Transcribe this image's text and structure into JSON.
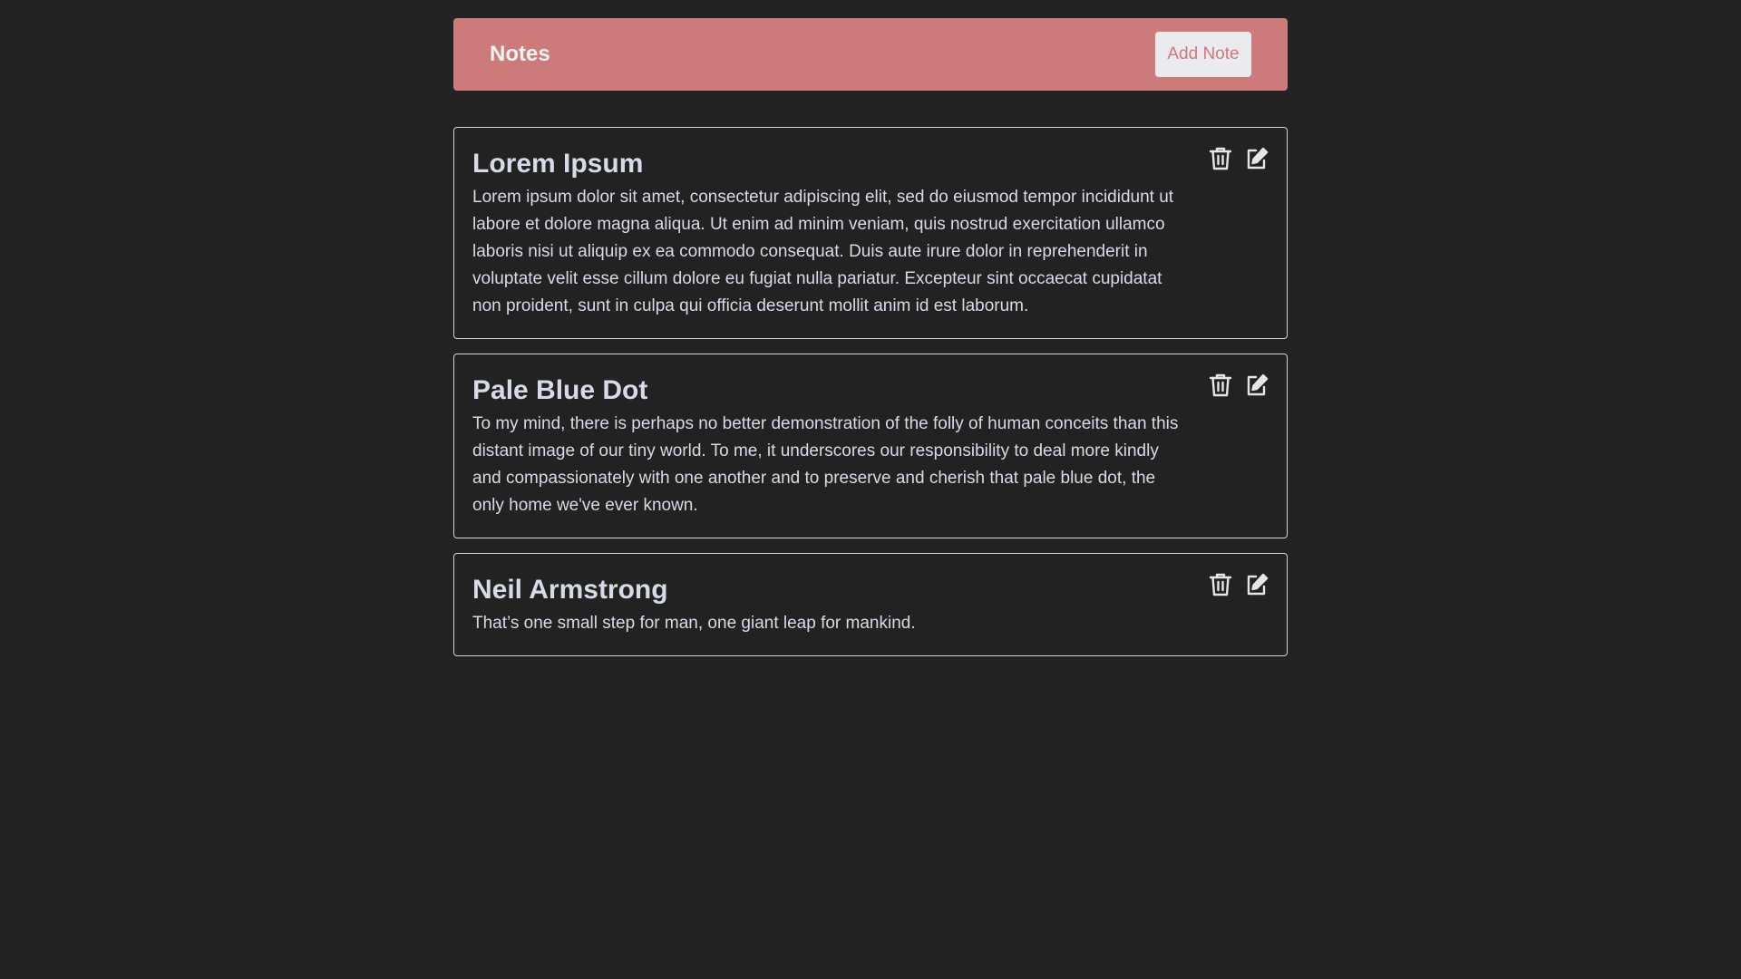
{
  "header": {
    "title": "Notes",
    "add_label": "Add Note"
  },
  "notes": [
    {
      "title": "Lorem Ipsum",
      "body": "Lorem ipsum dolor sit amet, consectetur adipiscing elit, sed do eiusmod tempor incididunt ut labore et dolore magna aliqua. Ut enim ad minim veniam, quis nostrud exercitation ullamco laboris nisi ut aliquip ex ea commodo consequat. Duis aute irure dolor in reprehenderit in voluptate velit esse cillum dolore eu fugiat nulla pariatur. Excepteur sint occaecat cupidatat non proident, sunt in culpa qui officia deserunt mollit anim id est laborum."
    },
    {
      "title": "Pale Blue Dot",
      "body": "To my mind, there is perhaps no better demonstration of the folly of human conceits than this distant image of our tiny world. To me, it underscores our responsibility to deal more kindly and compassionately with one another and to preserve and cherish that pale blue dot, the only home we've ever known."
    },
    {
      "title": "Neil Armstrong",
      "body": "That’s one small step for man, one giant leap for mankind."
    }
  ],
  "icons": {
    "delete": "trash-icon",
    "edit": "edit-icon"
  },
  "colors": {
    "background": "#222222",
    "header": "#cd7a7b",
    "button_bg": "#ebebef",
    "text": "#d7dbe7",
    "border": "#d5d5d5"
  }
}
